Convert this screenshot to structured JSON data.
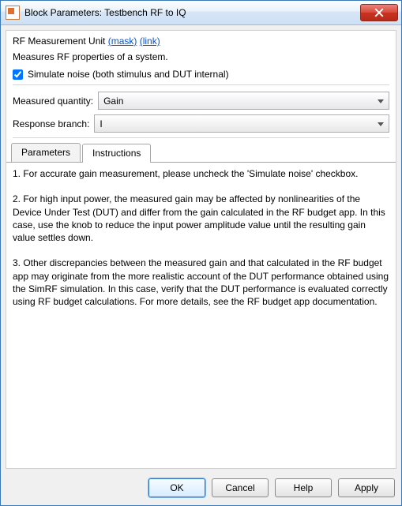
{
  "window": {
    "title": "Block Parameters: Testbench RF to IQ",
    "close_icon": "close-icon"
  },
  "mask": {
    "header_prefix": "RF Measurement Unit ",
    "header_mask_link": "(mask)",
    "header_link": "(link)",
    "description": "Measures RF properties of a system.",
    "simulate_noise_label": "Simulate noise (both stimulus and DUT internal)",
    "simulate_noise_checked": true
  },
  "fields": {
    "measured_quantity_label": "Measured quantity:",
    "measured_quantity_value": "Gain",
    "response_branch_label": "Response branch:",
    "response_branch_value": "I"
  },
  "tabs": {
    "parameters_label": "Parameters",
    "instructions_label": "Instructions",
    "active": "instructions"
  },
  "instructions": {
    "p1": "1. For accurate gain measurement, please uncheck the 'Simulate noise' checkbox.",
    "p2": "2. For high input power, the measured gain may be affected by nonlinearities of the Device Under Test (DUT) and differ from the gain calculated in the RF budget app. In this case, use the knob to reduce the input power amplitude value until the resulting gain value settles down.",
    "p3": "3. Other discrepancies between the measured gain and that calculated in the RF budget app may originate from the more realistic account of the DUT performance obtained using the SimRF simulation. In this case, verify that the DUT performance is evaluated correctly using RF budget calculations. For more details, see the RF budget app documentation."
  },
  "buttons": {
    "ok": "OK",
    "cancel": "Cancel",
    "help": "Help",
    "apply": "Apply"
  }
}
